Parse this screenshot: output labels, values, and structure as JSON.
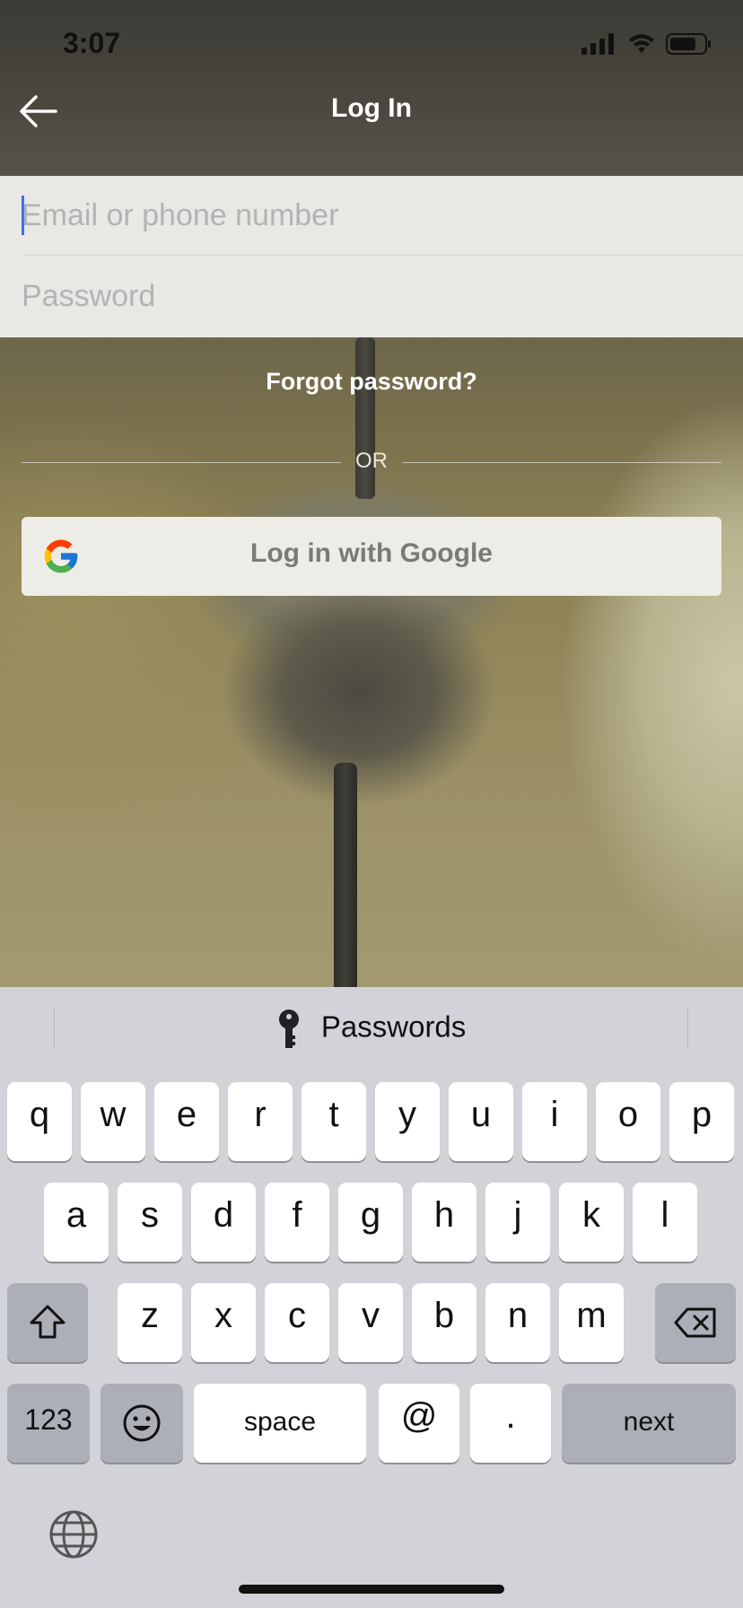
{
  "status_bar": {
    "time": "3:07"
  },
  "nav": {
    "title": "Log In"
  },
  "form": {
    "email_placeholder": "Email or phone number",
    "password_placeholder": "Password",
    "forgot": "Forgot password?",
    "or": "OR",
    "google_button": "Log in with Google"
  },
  "keyboard": {
    "suggestion": "Passwords",
    "row1": [
      "q",
      "w",
      "e",
      "r",
      "t",
      "y",
      "u",
      "i",
      "o",
      "p"
    ],
    "row2": [
      "a",
      "s",
      "d",
      "f",
      "g",
      "h",
      "j",
      "k",
      "l"
    ],
    "row3": [
      "z",
      "x",
      "c",
      "v",
      "b",
      "n",
      "m"
    ],
    "numbers_key": "123",
    "space_key": "space",
    "at_key": "@",
    "dot_key": ".",
    "next_key": "next"
  },
  "colors": {
    "caret": "#3a6df0",
    "keyboard_bg": "#d2d3d8",
    "key_dark": "#acafb7"
  }
}
